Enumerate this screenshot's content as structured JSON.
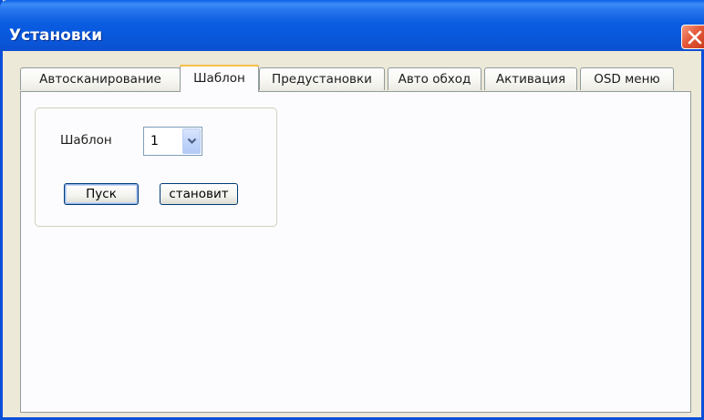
{
  "window": {
    "title": "Установки"
  },
  "tabs": [
    {
      "label": "Автосканирование",
      "active": false
    },
    {
      "label": "Шаблон",
      "active": true
    },
    {
      "label": "Предустановки",
      "active": false
    },
    {
      "label": "Авто обход",
      "active": false
    },
    {
      "label": "Активация",
      "active": false
    },
    {
      "label": "OSD меню",
      "active": false
    }
  ],
  "pattern_panel": {
    "pattern_label": "Шаблон",
    "pattern_select_value": "1",
    "start_button": "Пуск",
    "stop_button": "становит"
  },
  "colors": {
    "titlebar": "#0a5ce0",
    "active_tab_accent": "#e69a2c",
    "close_button": "#e4593a"
  },
  "icons": {
    "close": "close-icon",
    "dropdown": "chevron-down-icon"
  }
}
